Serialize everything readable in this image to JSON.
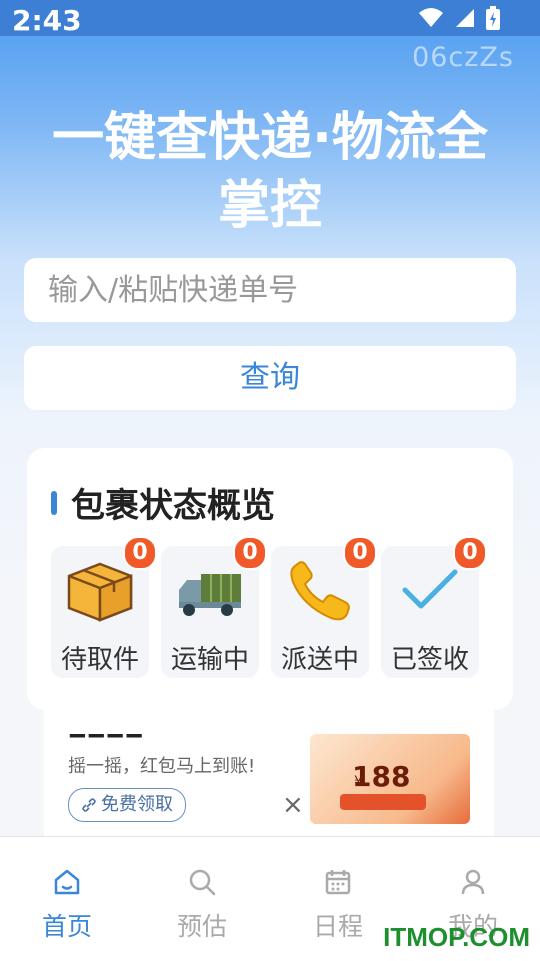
{
  "status_bar": {
    "time": "2:43"
  },
  "code_label": "06czZs",
  "headline": {
    "line1": "一键查快递·物流全",
    "line2": "掌控"
  },
  "search": {
    "placeholder": "输入/粘贴快递单号"
  },
  "query_button": "查询",
  "overview": {
    "title": "包裹状态概览",
    "items": [
      {
        "label": "待取件",
        "count": "0",
        "icon": "package-box-icon"
      },
      {
        "label": "运输中",
        "count": "0",
        "icon": "delivery-truck-icon"
      },
      {
        "label": "派送中",
        "count": "0",
        "icon": "phone-icon"
      },
      {
        "label": "已签收",
        "count": "0",
        "icon": "checkmark-icon"
      }
    ]
  },
  "ad": {
    "subtitle": "摇一摇，红包马上到账!",
    "button": "免费领取",
    "close": "×",
    "image_price": "188",
    "image_currency": "¥"
  },
  "tabs": [
    {
      "label": "首页",
      "icon": "home-icon",
      "active": true
    },
    {
      "label": "预估",
      "icon": "search-icon",
      "active": false
    },
    {
      "label": "日程",
      "icon": "calendar-icon",
      "active": false
    },
    {
      "label": "我的",
      "icon": "user-icon",
      "active": false
    }
  ],
  "watermark": "ITMOP.COM",
  "colors": {
    "accent": "#3a86d8",
    "badge": "#f05a28",
    "status_bar": "#3d7fd4"
  }
}
